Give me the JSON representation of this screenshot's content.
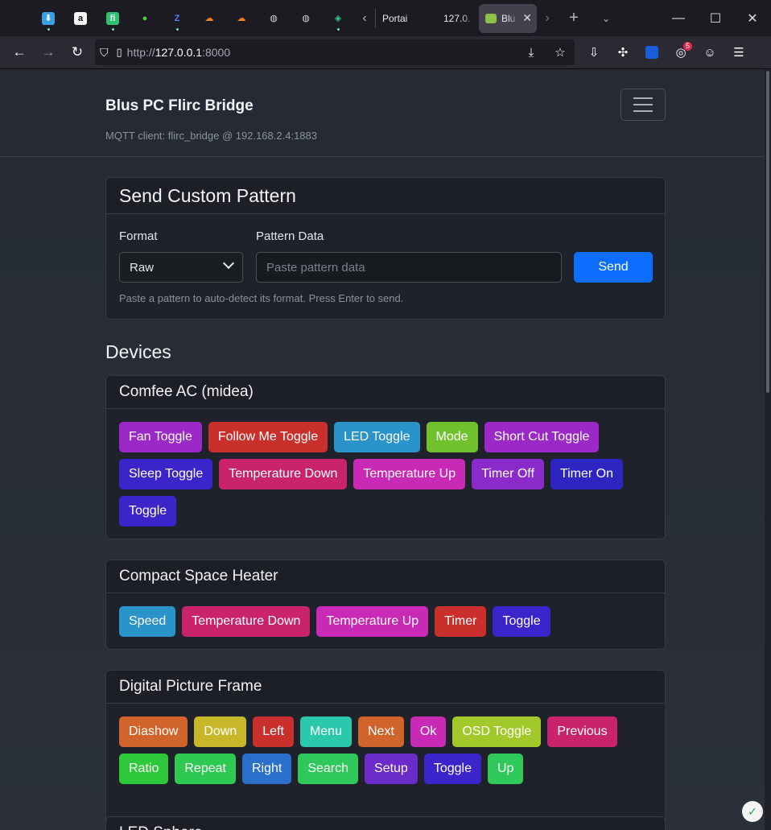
{
  "browser": {
    "pinned_icons": [
      {
        "name": "download-manager-icon",
        "glyph": "⬇",
        "bg": "#3aa0e6"
      },
      {
        "name": "amazon-icon",
        "glyph": "a",
        "bg": "#f5f5f5",
        "fg": "#111"
      },
      {
        "name": "fi-icon",
        "glyph": "fi",
        "bg": "#2fbf71"
      },
      {
        "name": "green-dot-icon",
        "glyph": "●",
        "bg": "transparent",
        "fg": "#4cd137"
      },
      {
        "name": "z-app-icon",
        "glyph": "Z",
        "bg": "transparent",
        "fg": "#5b7bff"
      },
      {
        "name": "cloudflare-icon",
        "glyph": "☁",
        "bg": "transparent",
        "fg": "#f48120"
      },
      {
        "name": "cloudflare-icon-2",
        "glyph": "☁",
        "bg": "transparent",
        "fg": "#f48120"
      },
      {
        "name": "globe-icon",
        "glyph": "◍",
        "bg": "transparent",
        "fg": "#cfcfd8"
      },
      {
        "name": "globe-icon-2",
        "glyph": "◍",
        "bg": "transparent",
        "fg": "#cfcfd8"
      },
      {
        "name": "gitea-icon",
        "glyph": "◈",
        "bg": "transparent",
        "fg": "#34c98a"
      }
    ],
    "tabs": [
      {
        "label": "Portai"
      },
      {
        "label": "127.0."
      },
      {
        "label": "Blu"
      }
    ],
    "url_proto": "http://",
    "url_host": "127.0.0.1",
    "url_rest": ":8000",
    "extension_badge": "5"
  },
  "header": {
    "brand": "Blus PC Flirc Bridge",
    "mqtt_status": "MQTT client: flirc_bridge @ 192.168.2.4:1883"
  },
  "custom_pattern": {
    "title": "Send Custom Pattern",
    "format_label": "Format",
    "format_value": "Raw",
    "pattern_label": "Pattern Data",
    "pattern_placeholder": "Paste pattern data",
    "send_label": "Send",
    "help": "Paste a pattern to auto-detect its format. Press Enter to send."
  },
  "devices_title": "Devices",
  "devices": [
    {
      "name": "Comfee AC (midea)",
      "buttons": [
        {
          "label": "Fan Toggle",
          "color": "#9b29c7"
        },
        {
          "label": "Follow Me Toggle",
          "color": "#c9302c"
        },
        {
          "label": "LED Toggle",
          "color": "#2a93c9"
        },
        {
          "label": "Mode",
          "color": "#6fc22e"
        },
        {
          "label": "Short Cut Toggle",
          "color": "#9b29c7"
        },
        {
          "label": "Sleep Toggle",
          "color": "#3b24c9"
        },
        {
          "label": "Temperature Down",
          "color": "#c9236b"
        },
        {
          "label": "Temperature Up",
          "color": "#c92ab5"
        },
        {
          "label": "Timer Off",
          "color": "#8a2bc9"
        },
        {
          "label": "Timer On",
          "color": "#2c25c2"
        },
        {
          "label": "Toggle",
          "color": "#3b24c9"
        }
      ]
    },
    {
      "name": "Compact Space Heater",
      "buttons": [
        {
          "label": "Speed",
          "color": "#2a93c9"
        },
        {
          "label": "Temperature Down",
          "color": "#c9236b"
        },
        {
          "label": "Temperature Up",
          "color": "#c92ab5"
        },
        {
          "label": "Timer",
          "color": "#c9302c"
        },
        {
          "label": "Toggle",
          "color": "#3b24c9"
        }
      ]
    },
    {
      "name": "Digital Picture Frame",
      "buttons": [
        {
          "label": "Diashow",
          "color": "#d0642a"
        },
        {
          "label": "Down",
          "color": "#c9b72a"
        },
        {
          "label": "Left",
          "color": "#c9302c"
        },
        {
          "label": "Menu",
          "color": "#2ac9ac"
        },
        {
          "label": "Next",
          "color": "#d0642a"
        },
        {
          "label": "Ok",
          "color": "#c92ab5"
        },
        {
          "label": "OSD Toggle",
          "color": "#a2c92a"
        },
        {
          "label": "Previous",
          "color": "#c9236b"
        },
        {
          "label": "Ratio",
          "color": "#2ec93a"
        },
        {
          "label": "Repeat",
          "color": "#2ec952"
        },
        {
          "label": "Right",
          "color": "#2a6fc9"
        },
        {
          "label": "Search",
          "color": "#2ec95a"
        },
        {
          "label": "Setup",
          "color": "#6a2bc9"
        },
        {
          "label": "Toggle",
          "color": "#3b24c9"
        },
        {
          "label": "Up",
          "color": "#2ec95a"
        }
      ]
    },
    {
      "name": "LED Sphere",
      "buttons": []
    }
  ]
}
